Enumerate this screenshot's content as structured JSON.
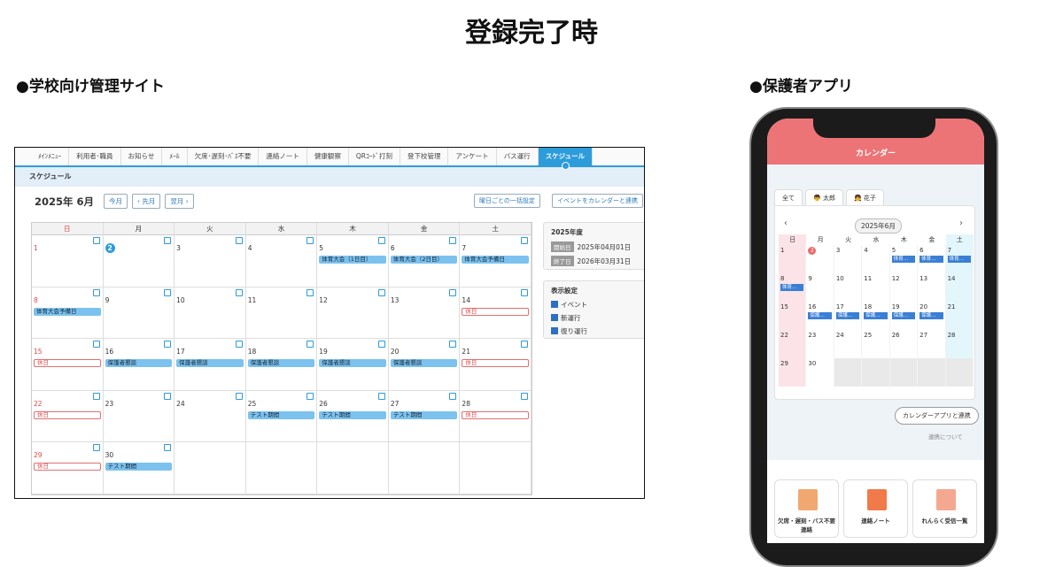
{
  "title": "登録完了時",
  "admin_section": "●学校向け管理サイト",
  "app_section": "●保護者アプリ",
  "admin": {
    "tabs": [
      "ﾒｲﾝﾒﾆｭｰ",
      "利用者･職員",
      "お知らせ",
      "ﾒｰﾙ",
      "欠席･遅刻･ﾊﾞｽ不要",
      "連絡ノート",
      "健康観察",
      "QRｺｰﾄﾞ打刻",
      "登下校管理",
      "アンケート",
      "バス運行",
      "スケジュール"
    ],
    "subheader": "スケジュール",
    "month": "2025年 6月",
    "today_btn": "今月",
    "prev_btn": "‹ 先月",
    "next_btn": "翌月 ›",
    "bulk_btn": "曜日ごとの一括設定",
    "link_btn": "イベントをカレンダーと連携",
    "weekdays": [
      "日",
      "月",
      "火",
      "水",
      "木",
      "金",
      "土"
    ],
    "weeks": [
      [
        {
          "d": "1",
          "red": true
        },
        {
          "d": "2",
          "today": true
        },
        {
          "d": "3"
        },
        {
          "d": "4"
        },
        {
          "d": "5",
          "ev": "体育大会（1日目）"
        },
        {
          "d": "6",
          "ev": "体育大会（2日目）"
        },
        {
          "d": "7",
          "ev": "体育大会予備日"
        }
      ],
      [
        {
          "d": "8",
          "red": true,
          "ev": "体育大会予備日"
        },
        {
          "d": "9"
        },
        {
          "d": "10"
        },
        {
          "d": "11"
        },
        {
          "d": "12"
        },
        {
          "d": "13"
        },
        {
          "d": "14",
          "hol": "休日"
        }
      ],
      [
        {
          "d": "15",
          "red": true,
          "hol": "休日"
        },
        {
          "d": "16",
          "ev": "保護者懇談"
        },
        {
          "d": "17",
          "ev": "保護者懇談"
        },
        {
          "d": "18",
          "ev": "保護者懇談"
        },
        {
          "d": "19",
          "ev": "保護者懇談"
        },
        {
          "d": "20",
          "ev": "保護者懇談"
        },
        {
          "d": "21",
          "hol": "休日"
        }
      ],
      [
        {
          "d": "22",
          "red": true,
          "hol": "休日"
        },
        {
          "d": "23"
        },
        {
          "d": "24"
        },
        {
          "d": "25",
          "ev": "テスト期間"
        },
        {
          "d": "26",
          "ev": "テスト期間"
        },
        {
          "d": "27",
          "ev": "テスト期間"
        },
        {
          "d": "28",
          "hol": "休日"
        }
      ],
      [
        {
          "d": "29",
          "red": true,
          "hol": "休日"
        },
        {
          "d": "30",
          "ev": "テスト期間"
        },
        {},
        {},
        {},
        {},
        {}
      ]
    ],
    "fy": {
      "title": "2025年度",
      "start_label": "開始日",
      "start": "2025年04月01日",
      "end_label": "終了日",
      "end": "2026年03月31日"
    },
    "display": {
      "title": "表示設定",
      "items": [
        "イベント",
        "新運行",
        "復り運行"
      ]
    }
  },
  "app": {
    "header": "カレンダー",
    "tabs": [
      "全て",
      "太郎",
      "花子"
    ],
    "month": "2025年6月",
    "weekdays": [
      "日",
      "月",
      "火",
      "水",
      "木",
      "金",
      "土"
    ],
    "weeks": [
      [
        {
          "d": "1"
        },
        {
          "d": "2",
          "badge": true
        },
        {
          "d": "3"
        },
        {
          "d": "4"
        },
        {
          "d": "5",
          "ev": "体育…"
        },
        {
          "d": "6",
          "ev": "体育…"
        },
        {
          "d": "7",
          "ev": "体育…"
        }
      ],
      [
        {
          "d": "8",
          "ev": "体育…"
        },
        {
          "d": "9"
        },
        {
          "d": "10"
        },
        {
          "d": "11"
        },
        {
          "d": "12"
        },
        {
          "d": "13"
        },
        {
          "d": "14"
        }
      ],
      [
        {
          "d": "15"
        },
        {
          "d": "16",
          "ev": "保護…"
        },
        {
          "d": "17",
          "ev": "保護…"
        },
        {
          "d": "18",
          "ev": "保護…"
        },
        {
          "d": "19",
          "ev": "保護…"
        },
        {
          "d": "20",
          "ev": "保護…"
        },
        {
          "d": "21"
        }
      ],
      [
        {
          "d": "22"
        },
        {
          "d": "23"
        },
        {
          "d": "24"
        },
        {
          "d": "25"
        },
        {
          "d": "26"
        },
        {
          "d": "27"
        },
        {
          "d": "28"
        }
      ],
      [
        {
          "d": "29"
        },
        {
          "d": "30"
        },
        {},
        {},
        {},
        {},
        {}
      ]
    ],
    "link_btn": "カレンダーアプリと連携",
    "about": "連携について",
    "cards": [
      "欠席・遅刻・バス不要\n連絡",
      "連絡ノート",
      "れんらく受信一覧"
    ]
  }
}
